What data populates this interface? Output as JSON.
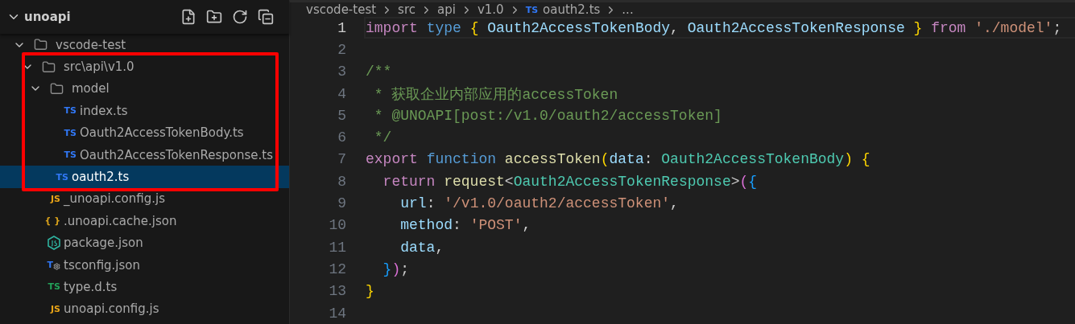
{
  "explorer": {
    "title": "unoapi",
    "expanded": true,
    "tree": [
      {
        "name": "vscode-test",
        "kind": "folder",
        "expanded": true,
        "children": [
          {
            "name": "src\\api\\v1.0",
            "kind": "folder",
            "expanded": true,
            "highlighted": true,
            "children": [
              {
                "name": "model",
                "kind": "folder",
                "expanded": true,
                "children": [
                  {
                    "name": "index.ts",
                    "kind": "ts-file",
                    "badge": "TS",
                    "color": "#3178f6",
                    "selected": false
                  },
                  {
                    "name": "Oauth2AccessTokenBody.ts",
                    "kind": "ts-file",
                    "badge": "TS",
                    "color": "#3178f6",
                    "selected": false
                  },
                  {
                    "name": "Oauth2AccessTokenResponse.ts",
                    "kind": "ts-file",
                    "badge": "TS",
                    "color": "#3178f6",
                    "selected": false
                  }
                ]
              },
              {
                "name": "oauth2.ts",
                "kind": "ts-file",
                "badge": "TS",
                "color": "#3178f6",
                "selected": true
              }
            ]
          },
          {
            "name": "_unoapi.config.js",
            "kind": "js-file",
            "badge": "JS",
            "color": "#e8a317",
            "selected": false
          },
          {
            "name": ".unoapi.cache.json",
            "kind": "json-file",
            "badge": "{ }",
            "color": "#d9a21b",
            "selected": false
          },
          {
            "name": "package.json",
            "kind": "node-file",
            "color": "#2fb3a0",
            "selected": false
          },
          {
            "name": "tsconfig.json",
            "kind": "tsconfig-file",
            "badge": "T",
            "color": "#3178f6",
            "selected": false
          },
          {
            "name": "type.d.ts",
            "kind": "ts-file",
            "badge": "TS",
            "color": "#23a35a",
            "selected": false
          },
          {
            "name": "unoapi.config.js",
            "kind": "js-file",
            "badge": "JS",
            "color": "#e8a317",
            "selected": false
          }
        ]
      }
    ]
  },
  "breadcrumb": [
    {
      "label": "vscode-test",
      "kind": "folder"
    },
    {
      "label": "src",
      "kind": "folder"
    },
    {
      "label": "api",
      "kind": "folder"
    },
    {
      "label": "v1.0",
      "kind": "folder"
    },
    {
      "label": "oauth2.ts",
      "kind": "file",
      "badge": "TS"
    },
    {
      "label": "...",
      "kind": "more"
    }
  ],
  "editor": {
    "lines": [
      {
        "number": "1",
        "current": true,
        "tokens": [
          {
            "text": "import ",
            "kind": "control"
          },
          {
            "text": "type ",
            "kind": "storage"
          },
          {
            "text": "{ ",
            "kind": "bracket1"
          },
          {
            "text": "Oauth2AccessTokenBody",
            "kind": "variable"
          },
          {
            "text": ", ",
            "kind": "punct"
          },
          {
            "text": "Oauth2AccessTokenResponse ",
            "kind": "variable"
          },
          {
            "text": "} ",
            "kind": "bracket1"
          },
          {
            "text": "from ",
            "kind": "control"
          },
          {
            "text": "'./model'",
            "kind": "string"
          },
          {
            "text": ";",
            "kind": "punct"
          }
        ]
      },
      {
        "number": "2",
        "current": false
      },
      {
        "number": "3",
        "current": false,
        "tokens": [
          {
            "text": "/**",
            "kind": "comment"
          }
        ]
      },
      {
        "number": "4",
        "current": false,
        "tokens": [
          {
            "text": " * 获取企业内部应用的accessToken",
            "kind": "comment"
          }
        ]
      },
      {
        "number": "5",
        "current": false,
        "tokens": [
          {
            "text": " * @UNOAPI[post:/v1.0/oauth2/accessToken]",
            "kind": "comment"
          }
        ]
      },
      {
        "number": "6",
        "current": false,
        "tokens": [
          {
            "text": " */",
            "kind": "comment"
          }
        ]
      },
      {
        "number": "7",
        "current": false,
        "tokens": [
          {
            "text": "export ",
            "kind": "control"
          },
          {
            "text": "function ",
            "kind": "storage"
          },
          {
            "text": "accessToken",
            "kind": "function"
          },
          {
            "text": "(",
            "kind": "bracket1"
          },
          {
            "text": "data",
            "kind": "variable"
          },
          {
            "text": ": ",
            "kind": "punct"
          },
          {
            "text": "Oauth2AccessTokenBody",
            "kind": "type"
          },
          {
            "text": ") ",
            "kind": "bracket1"
          },
          {
            "text": "{",
            "kind": "bracket1"
          }
        ]
      },
      {
        "number": "8",
        "current": false,
        "tokens": [
          {
            "text": "  return ",
            "kind": "control"
          },
          {
            "text": "request",
            "kind": "function"
          },
          {
            "text": "<",
            "kind": "punct"
          },
          {
            "text": "Oauth2AccessTokenResponse",
            "kind": "type"
          },
          {
            "text": ">",
            "kind": "punct"
          },
          {
            "text": "(",
            "kind": "bracket2"
          },
          {
            "text": "{",
            "kind": "bracket3"
          }
        ]
      },
      {
        "number": "9",
        "current": false,
        "tokens": [
          {
            "text": "    url",
            "kind": "variable"
          },
          {
            "text": ": ",
            "kind": "punct"
          },
          {
            "text": "'/v1.0/oauth2/accessToken'",
            "kind": "string"
          },
          {
            "text": ",",
            "kind": "punct"
          }
        ]
      },
      {
        "number": "10",
        "current": false,
        "tokens": [
          {
            "text": "    method",
            "kind": "variable"
          },
          {
            "text": ": ",
            "kind": "punct"
          },
          {
            "text": "'POST'",
            "kind": "string"
          },
          {
            "text": ",",
            "kind": "punct"
          }
        ]
      },
      {
        "number": "11",
        "current": false,
        "tokens": [
          {
            "text": "    data",
            "kind": "variable"
          },
          {
            "text": ",",
            "kind": "punct"
          }
        ]
      },
      {
        "number": "12",
        "current": false,
        "tokens": [
          {
            "text": "  }",
            "kind": "bracket3"
          },
          {
            "text": ")",
            "kind": "bracket2"
          },
          {
            "text": ";",
            "kind": "punct"
          }
        ]
      },
      {
        "number": "13",
        "current": false,
        "tokens": [
          {
            "text": "}",
            "kind": "bracket1"
          }
        ]
      },
      {
        "number": "14",
        "current": false
      }
    ]
  }
}
